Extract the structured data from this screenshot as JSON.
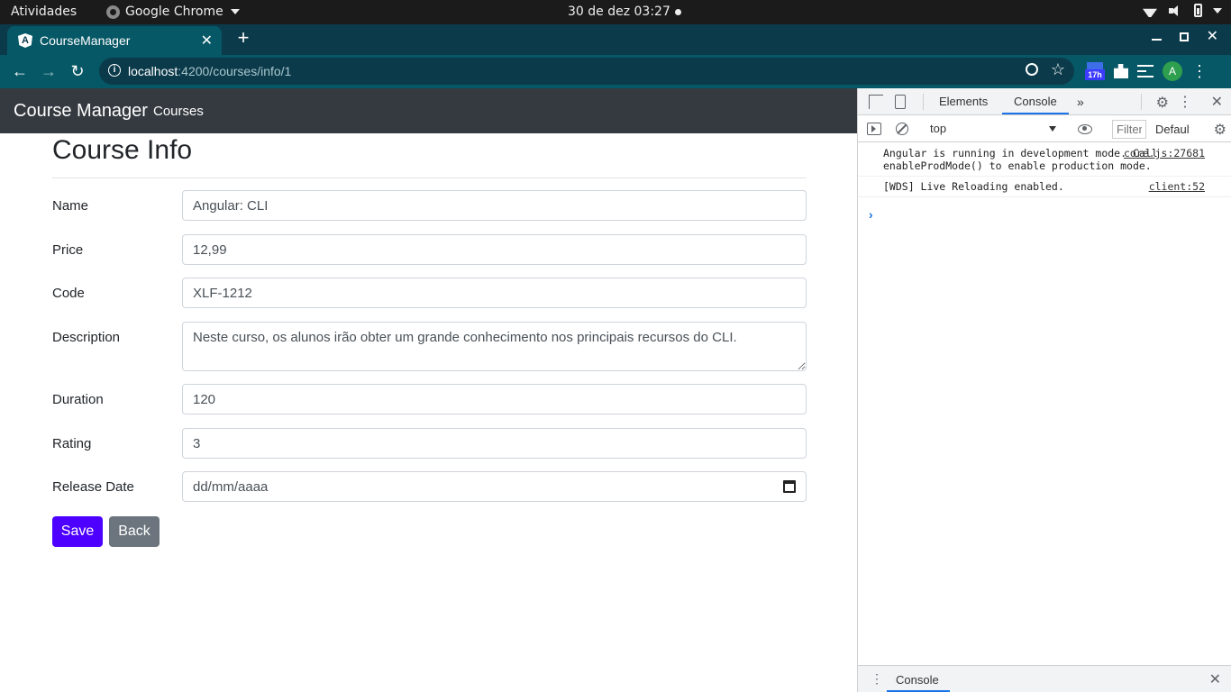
{
  "system": {
    "activities": "Atividades",
    "app_name": "Google Chrome",
    "clock": "30 de dez  03:27"
  },
  "browser": {
    "tab_title": "CourseManager",
    "url_host": "localhost",
    "url_path": ":4200/courses/info/1",
    "extension_badge": "17h",
    "avatar_letter": "A"
  },
  "app": {
    "brand": "Course Manager",
    "nav_link": "Courses",
    "page_title": "Course Info",
    "fields": {
      "name": {
        "label": "Name",
        "value": "Angular: CLI"
      },
      "price": {
        "label": "Price",
        "value": "12,99"
      },
      "code": {
        "label": "Code",
        "value": "XLF-1212"
      },
      "description": {
        "label": "Description",
        "value": "Neste curso, os alunos irão obter um grande conhecimento nos principais recursos do CLI."
      },
      "duration": {
        "label": "Duration",
        "value": "120"
      },
      "rating": {
        "label": "Rating",
        "value": "3"
      },
      "release_date": {
        "label": "Release Date",
        "value": "dd/mm/aaaa"
      }
    },
    "save_label": "Save",
    "back_label": "Back",
    "colors": {
      "save": "#4d00ff",
      "back": "#6c757d",
      "navbar": "#343a40"
    }
  },
  "devtools": {
    "tab_elements": "Elements",
    "tab_console": "Console",
    "context": "top",
    "filter_placeholder": "Filter",
    "levels": "Default levels",
    "logs": [
      {
        "message": "Angular is running in development mode. Call enableProdMode() to enable production mode.",
        "source": "core.js:27681"
      },
      {
        "message": "[WDS] Live Reloading enabled.",
        "source": "client:52"
      }
    ],
    "drawer_tab": "Console"
  }
}
